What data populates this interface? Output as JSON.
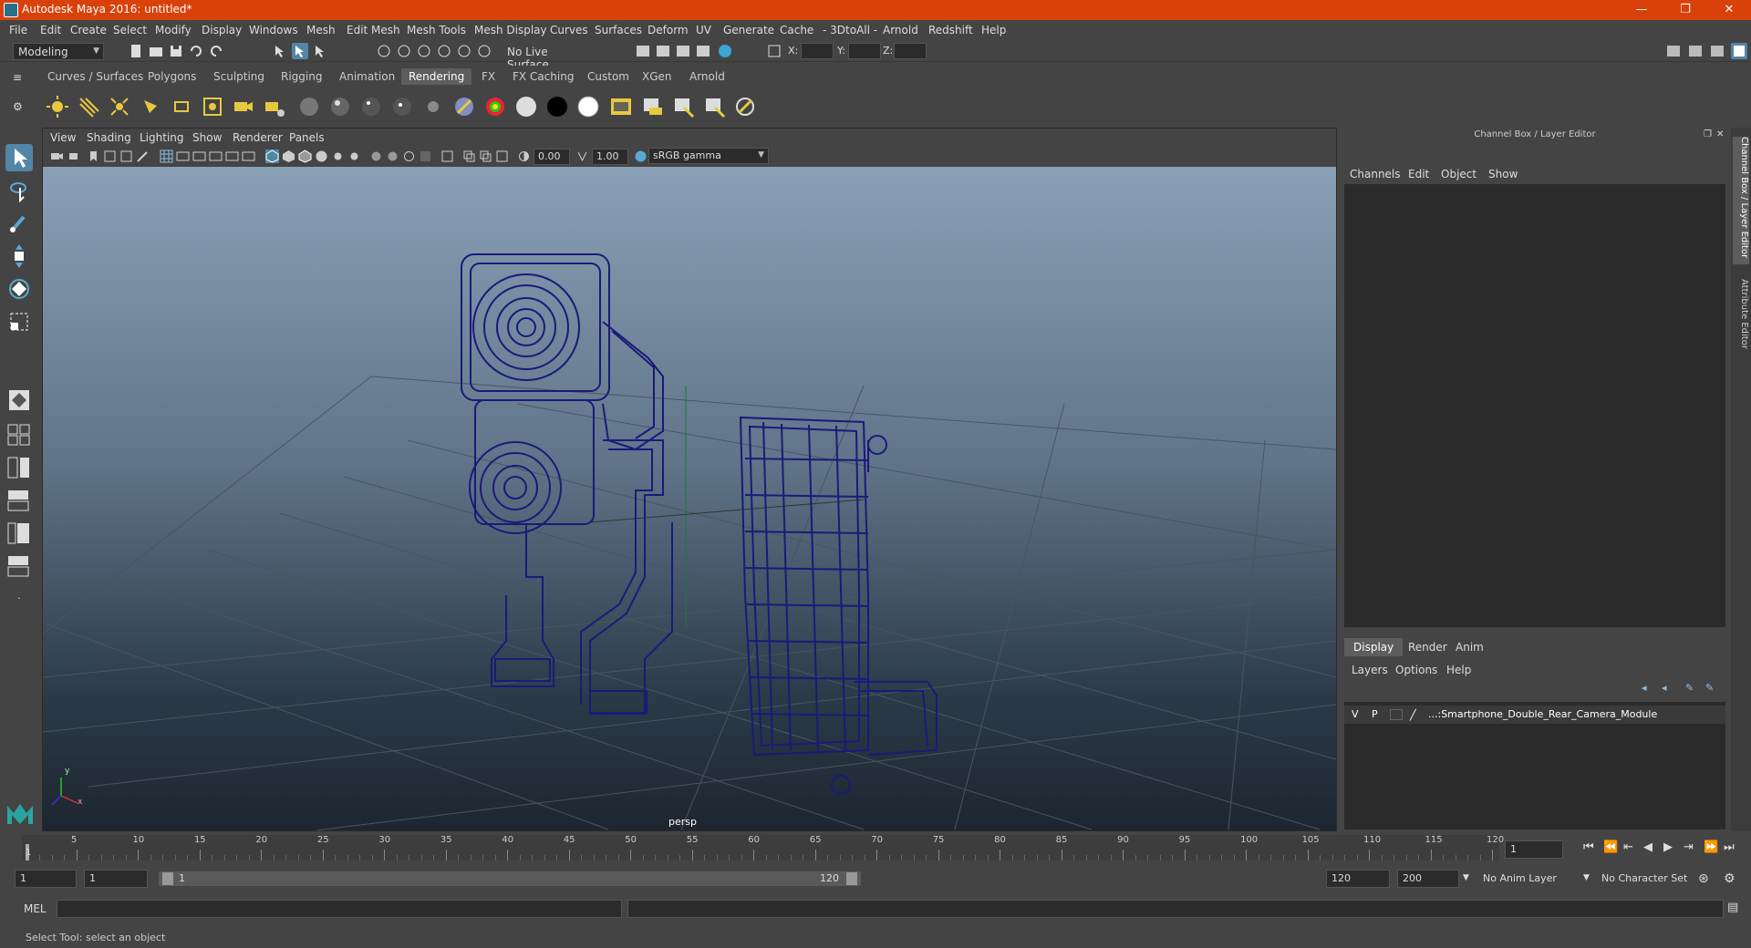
{
  "window": {
    "title": "Autodesk Maya 2016: untitled*",
    "minimize": "—",
    "maximize": "❐",
    "close": "✕"
  },
  "menus": [
    "File",
    "Edit",
    "Create",
    "Select",
    "Modify",
    "Display",
    "Windows",
    "Mesh",
    "Edit Mesh",
    "Mesh Tools",
    "Mesh Display",
    "Curves",
    "Surfaces",
    "Deform",
    "UV",
    "Generate",
    "Cache",
    "- 3DtoAll -",
    "Arnold",
    "Redshift",
    "Help"
  ],
  "statusline": {
    "mode": "Modeling",
    "live_surface": "No Live Surface",
    "x_label": "X:",
    "y_label": "Y:",
    "z_label": "Z:"
  },
  "shelf_tabs": [
    "Curves / Surfaces",
    "Polygons",
    "Sculpting",
    "Rigging",
    "Animation",
    "Rendering",
    "FX",
    "FX Caching",
    "Custom",
    "XGen",
    "Arnold"
  ],
  "shelf_active": "Rendering",
  "viewport": {
    "menus": [
      "View",
      "Shading",
      "Lighting",
      "Show",
      "Renderer",
      "Panels"
    ],
    "exposure": "0.00",
    "gamma": "1.00",
    "color_space": "sRGB gamma",
    "camera_label": "persp",
    "axis_y": "y",
    "axis_x": "x"
  },
  "channel_box": {
    "title": "Channel Box / Layer Editor",
    "menus": [
      "Channels",
      "Edit",
      "Object",
      "Show"
    ],
    "layer_tabs": [
      "Display",
      "Render",
      "Anim"
    ],
    "layer_active": "Display",
    "layer_menus": [
      "Layers",
      "Options",
      "Help"
    ],
    "layer": {
      "v": "V",
      "p": "P",
      "name": "...:Smartphone_Double_Rear_Camera_Module"
    },
    "side_tabs": [
      "Channel Box / Layer Editor",
      "Attribute Editor"
    ]
  },
  "timeline": {
    "labels": [
      "5",
      "10",
      "15",
      "20",
      "25",
      "30",
      "35",
      "40",
      "45",
      "50",
      "55",
      "60",
      "65",
      "70",
      "75",
      "80",
      "85",
      "90",
      "95",
      "100",
      "105",
      "110",
      "115",
      "120"
    ],
    "current": "1",
    "current_frame_field": "1"
  },
  "range": {
    "start": "1",
    "playback_start": "1",
    "bar_start": "1",
    "bar_end": "120",
    "playback_end": "120",
    "end": "200",
    "anim_layer": "No Anim Layer",
    "char_set": "No Character Set"
  },
  "command": {
    "lang": "MEL"
  },
  "help_line": "Select Tool: select an object",
  "colors": {
    "title_bar": "#d9410b",
    "active_tool": "#5285a6",
    "wireframe": "#1a1a7a"
  }
}
